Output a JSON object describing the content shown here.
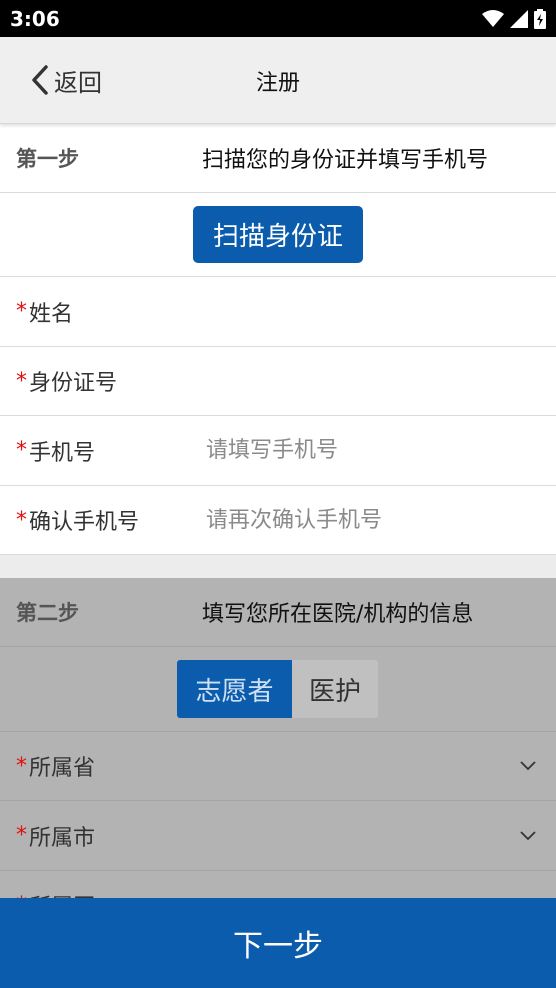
{
  "status_bar": {
    "time": "3:06"
  },
  "nav": {
    "back_label": "返回",
    "title": "注册"
  },
  "step1": {
    "label": "第一步",
    "description": "扫描您的身份证并填写手机号",
    "scan_button": "扫描身份证",
    "fields": [
      {
        "label": "姓名",
        "value": "",
        "placeholder": ""
      },
      {
        "label": "身份证号",
        "value": "",
        "placeholder": ""
      },
      {
        "label": "手机号",
        "value": "",
        "placeholder": "请填写手机号"
      },
      {
        "label": "确认手机号",
        "value": "",
        "placeholder": "请再次确认手机号"
      }
    ]
  },
  "step2": {
    "label": "第二步",
    "description": "填写您所在医院/机构的信息",
    "roles": [
      "志愿者",
      "医护"
    ],
    "selected_role": "志愿者",
    "fields": [
      {
        "label": "所属省"
      },
      {
        "label": "所属市"
      },
      {
        "label": "所属区"
      }
    ]
  },
  "footer": {
    "next_button": "下一步"
  },
  "colors": {
    "primary": "#0b5cad",
    "required": "#e01010",
    "section_overlay": "#b3b3b3"
  },
  "icons": [
    "wifi-icon",
    "signal-icon",
    "battery-icon",
    "back-chevron-icon",
    "dropdown-chevron-icon"
  ]
}
